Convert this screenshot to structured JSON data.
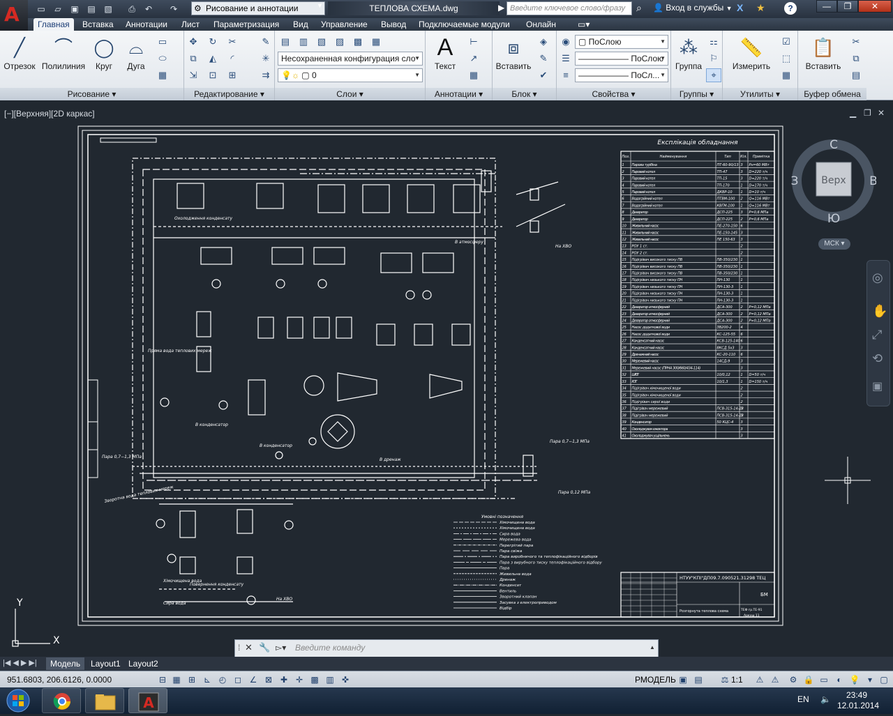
{
  "window": {
    "workspace": "Рисование и аннотации",
    "doc_title": "ТЕПЛОВА СХЕМА.dwg",
    "search_placeholder": "Введите ключевое слово/фразу",
    "sign_in": "Вход в службы",
    "help": "?"
  },
  "ribbon_tabs": [
    "Главная",
    "Вставка",
    "Аннотации",
    "Лист",
    "Параметризация",
    "Вид",
    "Управление",
    "Вывод",
    "Подключаемые модули",
    "Онлайн"
  ],
  "ribbon": {
    "draw": {
      "title": "Рисование",
      "line": "Отрезок",
      "polyline": "Полилиния",
      "circle": "Круг",
      "arc": "Дуга"
    },
    "modify": {
      "title": "Редактирование"
    },
    "layers": {
      "title": "Слои",
      "layer_state": "Несохраненная конфигурация сло",
      "current_layer": "0"
    },
    "annotations": {
      "title": "Аннотации",
      "text": "Текст"
    },
    "block": {
      "title": "Блок",
      "insert": "Вставить"
    },
    "properties": {
      "title": "Свойства",
      "color": "ПоСлою",
      "linetype": "ПоСлою",
      "lineweight": "ПоСл..."
    },
    "groups": {
      "title": "Группы",
      "group": "Группа"
    },
    "utilities": {
      "title": "Утилиты",
      "measure": "Измерить"
    },
    "clipboard": {
      "title": "Буфер обмена",
      "paste": "Вставить"
    }
  },
  "viewport": {
    "label": "[−][Верхняя][2D каркас]",
    "viewcube": {
      "top": "Верх",
      "north": "С",
      "south": "Ю",
      "east": "В",
      "west": "З"
    },
    "ucs": "МСК",
    "axis_x": "X",
    "axis_y": "Y"
  },
  "drawing": {
    "table_title": "Експлікація обладнання",
    "table_headers": [
      "Поз.",
      "Найменування",
      "Тип",
      "Кіл.",
      "Примітка"
    ],
    "table_rows": [
      [
        "1",
        "Парова турбіна",
        "ПТ-60-90/13",
        "3",
        "Рн=60 МВт"
      ],
      [
        "2",
        "Паровий котел",
        "ТП-47",
        "3",
        "D=220 т/ч"
      ],
      [
        "3",
        "Паровий котел",
        "ТП-15",
        "3",
        "D=220 т/ч"
      ],
      [
        "4",
        "Паровий котел",
        "ТП-170",
        "1",
        "D=170 т/ч"
      ],
      [
        "5",
        "Паровий котел",
        "ДКВР-10",
        "1",
        "D=10 т/ч"
      ],
      [
        "6",
        "Водогрійний котел",
        "ПТВМ-100",
        "2",
        "Q=116 МВт"
      ],
      [
        "7",
        "Водогрійний котел",
        "КВГМ-100",
        "1",
        "Q=116 МВт"
      ],
      [
        "8",
        "Деаэратор",
        "ДСП-225",
        "3",
        "P=0,6 МПа"
      ],
      [
        "9",
        "Деаэратор",
        "ДСП-225",
        "2",
        "P=0,6 МПа"
      ],
      [
        "10",
        "Живильний насос",
        "ПЕ-270-150",
        "6",
        ""
      ],
      [
        "11",
        "Живильний насос",
        "ПЕ-150-145",
        "3",
        ""
      ],
      [
        "12",
        "Живильний насос",
        "ПЕ 150-63",
        "3",
        ""
      ],
      [
        "13",
        "РОУ 1 ст.",
        "",
        "2",
        ""
      ],
      [
        "14",
        "РОУ 2 ст.",
        "",
        "2",
        ""
      ],
      [
        "15",
        "Підігрівач високого тиску ПВ",
        "ПВ-350/230",
        "1",
        ""
      ],
      [
        "16",
        "Підігрівач високого тиску ПВ",
        "ПВ-350/230",
        "1",
        ""
      ],
      [
        "17",
        "Підігрівач високого тиску ПВ",
        "ПВ-350/230",
        "1",
        ""
      ],
      [
        "18",
        "Підігрівач низького тиску ПН",
        "ПН-130",
        "1",
        ""
      ],
      [
        "19",
        "Підігрівач низького тиску ПН",
        "ПН-130-3",
        "1",
        ""
      ],
      [
        "20",
        "Підігрівач низького тиску ПН",
        "ПН-130-3",
        "1",
        ""
      ],
      [
        "21",
        "Підігрівач низького тиску ПН",
        "ПН-130-3",
        "1",
        ""
      ],
      [
        "22",
        "Деаэратор атмосферний",
        "ДСА-300",
        "2",
        "P=0,12 МПа"
      ],
      [
        "23",
        "Деаэратор атмосферний",
        "ДСА-300",
        "2",
        "P=0,12 МПа"
      ],
      [
        "24",
        "Деаэратор атмосферний",
        "ДСА-300",
        "2",
        "P=0,12 МПа"
      ],
      [
        "25",
        "Насос додаткової води",
        "ЗВ200-2",
        "4",
        ""
      ],
      [
        "26",
        "Насос додаткової води",
        "КС-125-55",
        "6",
        ""
      ],
      [
        "27",
        "Конденсатний насос",
        "КСВ-125-140",
        "6",
        ""
      ],
      [
        "28",
        "Конденсатний насос",
        "8КСД 5x3",
        "3",
        ""
      ],
      [
        "29",
        "Дренажний насос",
        "КС-20-110",
        "6",
        ""
      ],
      [
        "30",
        "Мережевий насос",
        "14СД-9",
        "3",
        ""
      ],
      [
        "31",
        "Мережевий насос (ПРНА 300/660/434-114)",
        "",
        "3",
        ""
      ],
      [
        "32",
        "ШРОТ",
        "10/0,12",
        "1",
        "D=50 т/ч"
      ],
      [
        "33",
        "РОТ",
        "10/1,3",
        "1",
        "D=150 т/ч"
      ],
      [
        "34",
        "Підігрівач хімочищеної води",
        "",
        "2",
        ""
      ],
      [
        "35",
        "Підігрівач хімочищеної води",
        "",
        "2",
        ""
      ],
      [
        "36",
        "Підігрівач сирої води",
        "",
        "2",
        ""
      ],
      [
        "37",
        "Підігрівач мережевий",
        "ПСВ-315-14-23",
        "3",
        ""
      ],
      [
        "38",
        "Підігрівач мережевий",
        "ПСВ-315-14-23",
        "3",
        ""
      ],
      [
        "39",
        "Конденсатор",
        "50 КЦС-4",
        "3",
        ""
      ],
      [
        "40",
        "Охолоджувач ежектора",
        "",
        "3",
        ""
      ],
      [
        "41",
        "Охолоджувач ущільнень",
        "",
        "3",
        ""
      ]
    ],
    "legend_title": "Умовні позначення",
    "legend_items": [
      "Хімочищена вода",
      "Хімочищена вода",
      "Сира вода",
      "Мережева вода",
      "Перегрітий пара",
      "Пара свіжа",
      "Пара виробничого та теплофікаційного відборів",
      "Пара з вирубного тиску теплофікаційного відбору",
      "Пара",
      "Живильна вода",
      "Дренаж",
      "Конденсат",
      "Вентиль",
      "Зворотний клапан",
      "Засувка з електроприводом",
      "Відбір"
    ],
    "stamp_code": "НТУУ\"КПІ\"ДП09.7.090521.31298 ТЕЦ",
    "stamp_title": "Розгорнута теплова схема",
    "stamp_grade": "БМ",
    "stamp_group": "ТЕФ гр.ТЕ-91",
    "stamp_sheet": "Аркуш 11",
    "labels": {
      "steam_07_13_left": "Пара 0,7−1,3 МПа",
      "steam_07_13_right": "Пара 0,7−1,3 МПа",
      "steam_012": "Пара 0,12 МПа",
      "return_water": "Зворотна вода теплових мереж",
      "direct_water": "Пряма вода теплових мереж",
      "to_xvo_1": "На ХВО",
      "to_xvo_2": "На ХВО",
      "chemical_water": "Хімочищена вода",
      "raw_water": "Сира вода",
      "condensate_return": "Повернення конденсату",
      "to_condenser": "В конденсатор",
      "to_condensers": "В конденсатор",
      "to_drainage": "В дренаж",
      "to_atmosphere": "В атмосферу",
      "cold_water": "Охолодження конденсату"
    }
  },
  "layout_tabs": [
    "Модель",
    "Layout1",
    "Layout2"
  ],
  "status": {
    "coords": "951.6803, 206.6126, 0.0000",
    "model": "РМОДЕЛЬ",
    "scale": "1:1"
  },
  "command": {
    "placeholder": "Введите команду"
  },
  "taskbar": {
    "lang": "EN",
    "time": "23:49",
    "date": "12.01.2014"
  },
  "colors": {
    "background": "#212830",
    "line": "#ffffff",
    "accent_red": "#d52a23",
    "ribbon": "#e8ecf1"
  }
}
